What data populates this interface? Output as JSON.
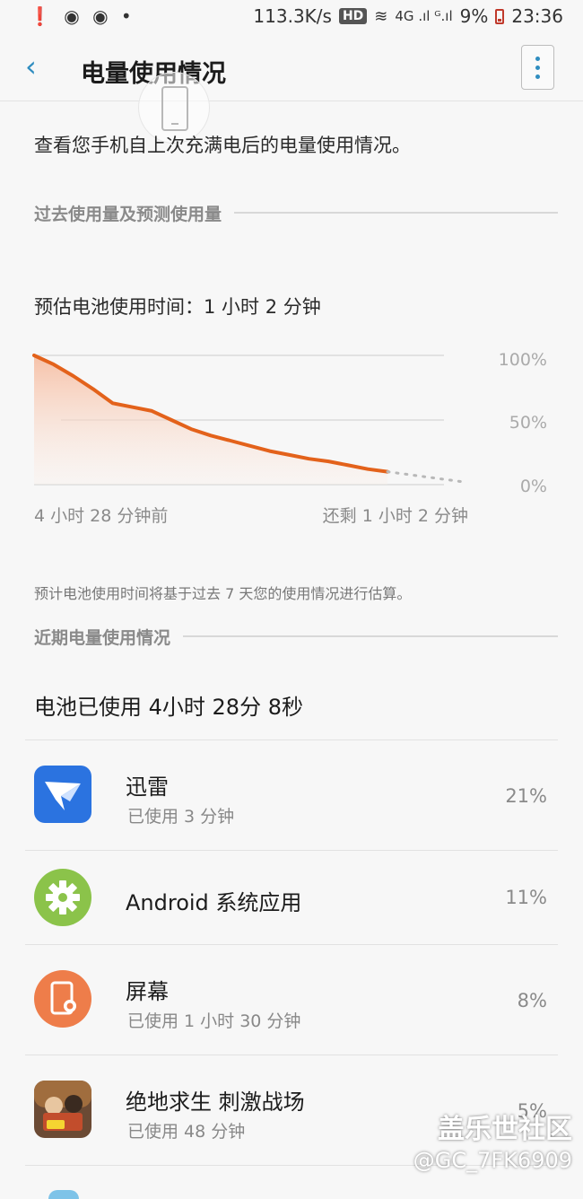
{
  "status_bar": {
    "left_icons": "❗ ◉ ◉ •",
    "net_speed": "113.3K/s",
    "hd": "HD",
    "signal": "4G .ıl ᴳ.ıl",
    "battery_percent": "9%",
    "time": "23:36"
  },
  "appbar": {
    "back_icon": "‹",
    "title": "电量使用情况"
  },
  "description": "查看您手机自上次充满电后的电量使用情况。",
  "section_past": "过去使用量及预测使用量",
  "estimate_label": "预估电池使用时间：1 小时 2 分钟",
  "chart_data": {
    "type": "area",
    "x_start_label": "4 小时 28 分钟前",
    "x_end_label": "还剩 1 小时 2 分钟",
    "y_ticks": [
      "100%",
      "50%",
      "0%"
    ],
    "ylim": [
      0,
      100
    ],
    "series": [
      {
        "values": [
          100,
          93,
          84,
          74,
          63,
          60,
          57,
          50,
          43,
          38,
          34,
          30,
          26,
          23,
          20,
          18,
          15,
          12,
          10
        ]
      }
    ],
    "projection": [
      10,
      6,
      2
    ],
    "accent": "#e3621b"
  },
  "footnote": "预计电池使用时间将基于过去 7 天您的使用情况进行估算。",
  "section_recent": "近期电量使用情况",
  "battery_used_total": "电池已使用 4小时 28分 8秒",
  "apps": [
    {
      "name": "迅雷",
      "sub": "已使用 3 分钟",
      "pct": "21%",
      "icon": "bird-icon",
      "color": "#2b73e0"
    },
    {
      "name": "Android 系统应用",
      "sub": "",
      "pct": "11%",
      "icon": "gear-icon",
      "color": "#8bc34a"
    },
    {
      "name": "屏幕",
      "sub": "已使用 1 小时 30 分钟",
      "pct": "8%",
      "icon": "screen-brightness-icon",
      "color": "#ee7d4a"
    },
    {
      "name": "绝地求生 刺激战场",
      "sub": "已使用 48 分钟",
      "pct": "5%",
      "icon": "game-icon",
      "color": "#c24d2c"
    }
  ],
  "watermark": {
    "line1": "盖乐世社区",
    "line2": "@GC_7FK6909"
  }
}
